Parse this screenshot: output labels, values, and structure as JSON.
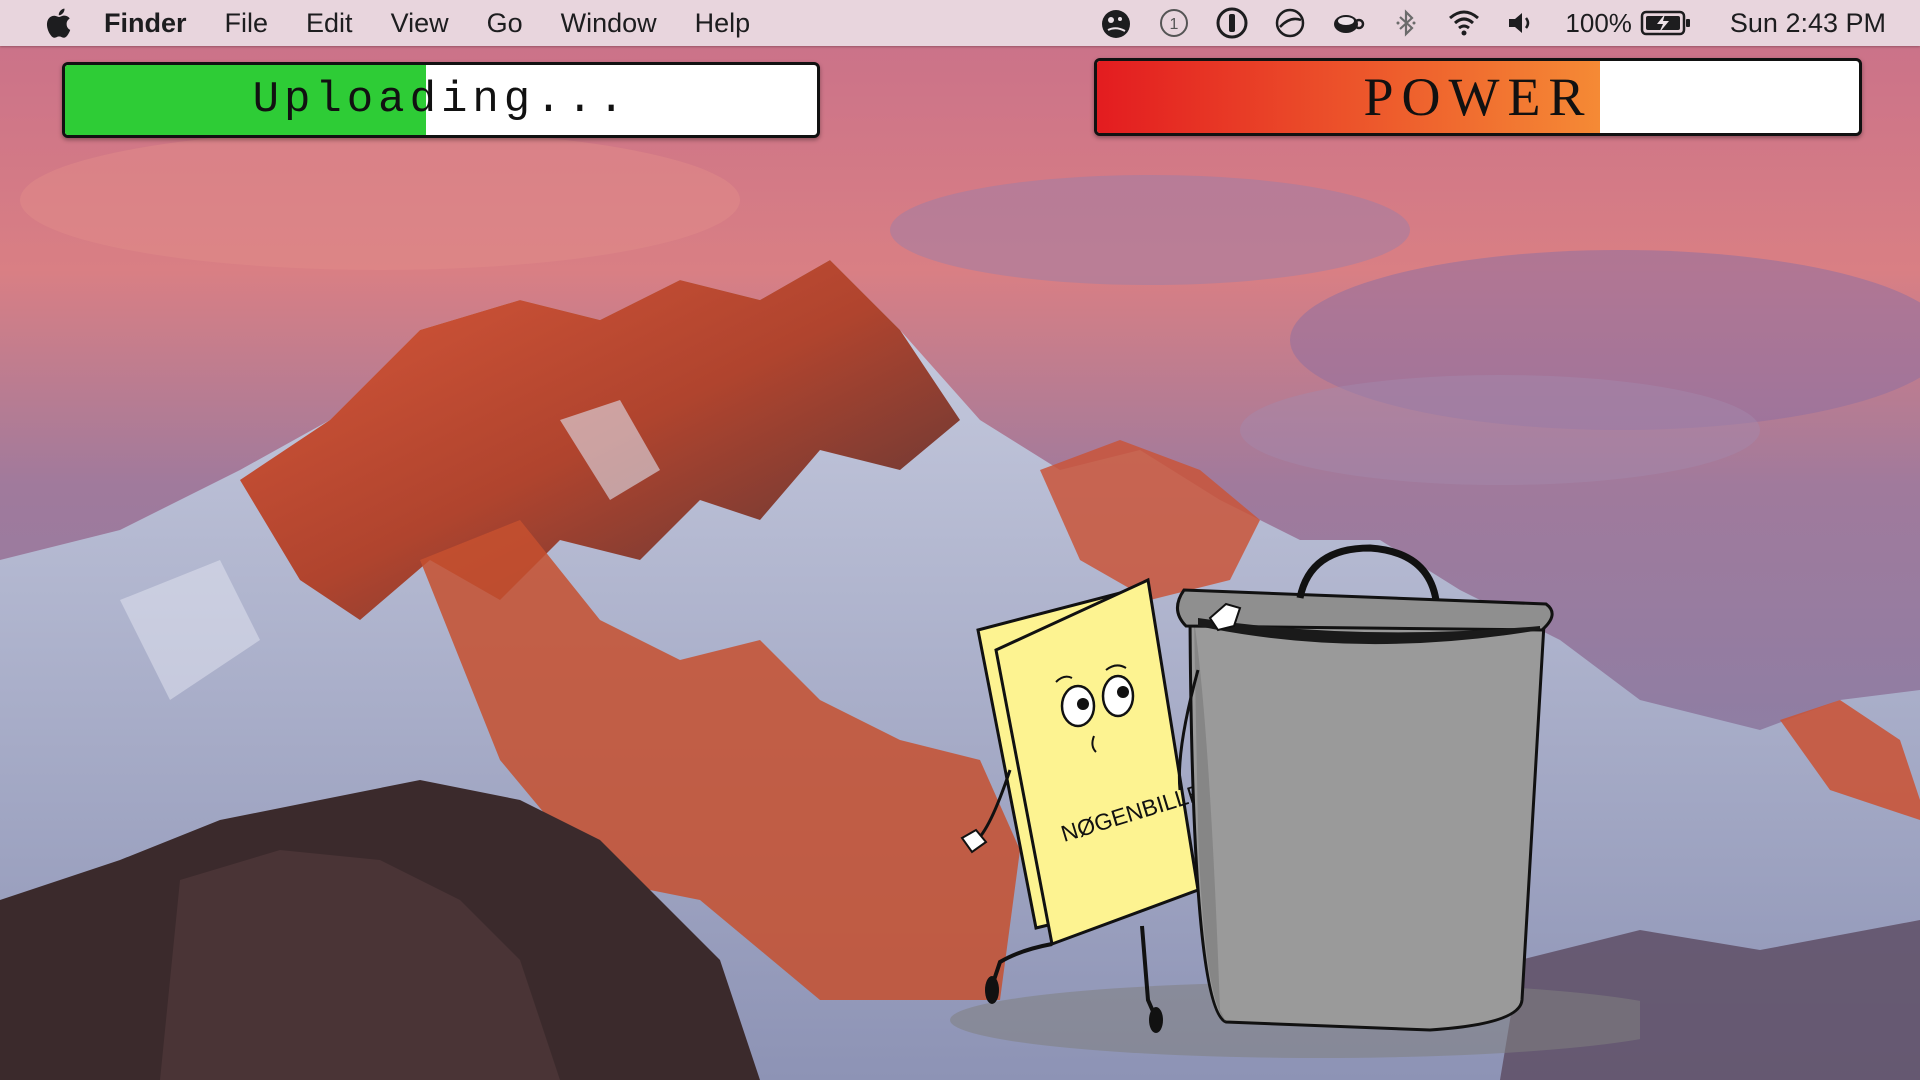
{
  "menubar": {
    "apple_icon": "apple-logo-icon",
    "app_name": "Finder",
    "items": [
      "File",
      "Edit",
      "View",
      "Go",
      "Window",
      "Help"
    ],
    "status_icons": [
      "creature-icon",
      "notification-count-icon",
      "password-manager-icon",
      "sync-icon",
      "coffee-cup-icon",
      "bluetooth-icon",
      "wifi-icon",
      "volume-icon"
    ],
    "notification_count": "1",
    "battery_percent": "100%",
    "battery_icon": "battery-charging-icon",
    "clock": "Sun 2:43 PM"
  },
  "upload_bar": {
    "label": "Uploading...",
    "progress": 0.48,
    "fill_color": "#2ecc36"
  },
  "power_bar": {
    "label": "POWER",
    "progress": 0.66,
    "fill_color": "#e31c20",
    "fill_color_end": "#f58a35"
  },
  "cartoon": {
    "document_label": "NØGENBILLEDER",
    "document_color": "#fdf391",
    "trash_color": "#9a9a9a"
  }
}
